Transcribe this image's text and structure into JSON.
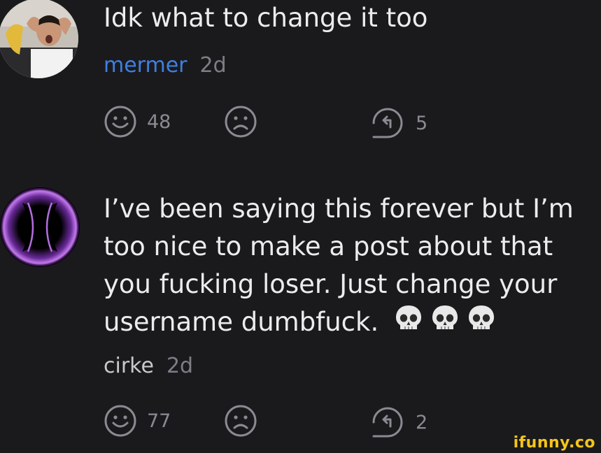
{
  "comments": [
    {
      "text_lines": [
        "Idk what to change it too"
      ],
      "author": "mermer",
      "age": "2d",
      "likes": "48",
      "replies": "5",
      "author_color": "#3f7fe0"
    },
    {
      "text_lines": [
        "I’ve been saying this forever but I’m",
        "too nice to make a post about that",
        "you fucking loser. Just change your",
        "username dumbfuck."
      ],
      "emoji": [
        "skull",
        "skull",
        "skull"
      ],
      "author": "cirke",
      "age": "2d",
      "likes": "77",
      "replies": "2"
    }
  ],
  "watermark": "ifunny.co",
  "colors": {
    "background": "#1a1a1d",
    "text": "#ececef",
    "muted": "#8a8a92",
    "link": "#3f7fe0",
    "watermark": "#f5c518"
  }
}
